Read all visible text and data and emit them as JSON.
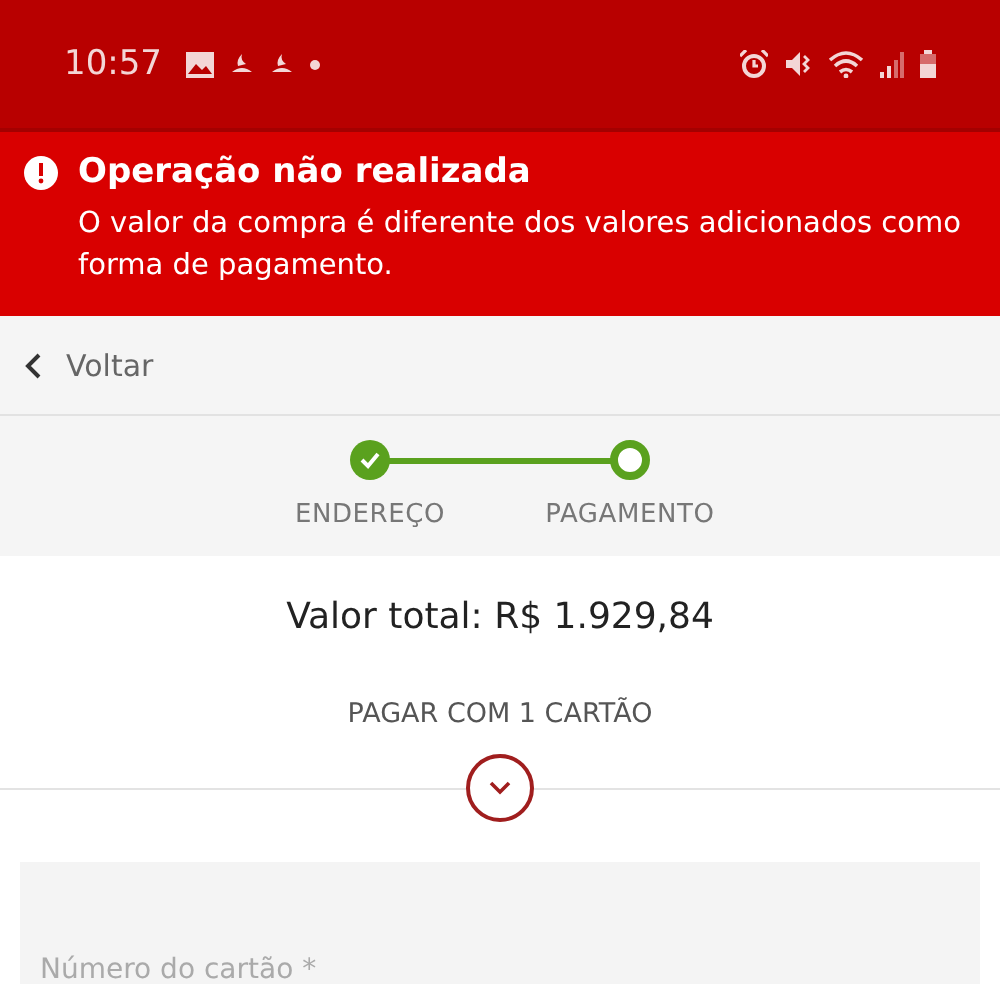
{
  "status_bar": {
    "time": "10:57"
  },
  "alert": {
    "title": "Operação não realizada",
    "message": "O valor da compra é diferente dos valores adicionados como forma de pagamento."
  },
  "nav": {
    "back_label": "Voltar"
  },
  "stepper": {
    "steps": [
      {
        "label": "ENDEREÇO",
        "completed": true
      },
      {
        "label": "PAGAMENTO",
        "completed": false
      }
    ]
  },
  "total": "Valor total: R$ 1.929,84",
  "payment_option": {
    "label": "PAGAR COM 1 CARTÃO",
    "expanded": false
  },
  "card_number_field": {
    "placeholder": "Número do cartão *"
  }
}
